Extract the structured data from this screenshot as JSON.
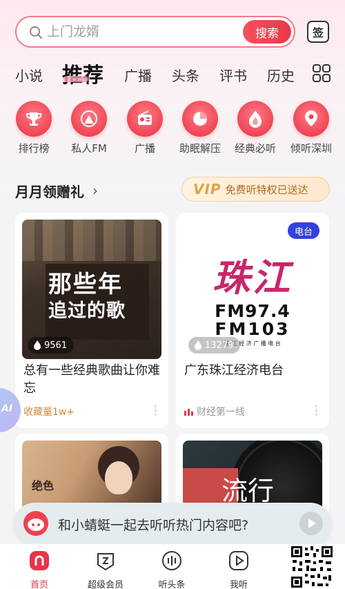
{
  "search": {
    "placeholder": "上门龙婿",
    "button_label": "搜索"
  },
  "sign_label": "签",
  "tabs": [
    {
      "label": "小说"
    },
    {
      "label": "推荐"
    },
    {
      "label": "广播"
    },
    {
      "label": "头条"
    },
    {
      "label": "评书"
    },
    {
      "label": "历史"
    }
  ],
  "quick_entries": [
    {
      "label": "排行榜",
      "icon": "trophy-icon"
    },
    {
      "label": "私人FM",
      "icon": "fm-icon"
    },
    {
      "label": "广播",
      "icon": "radio-icon"
    },
    {
      "label": "助眠解压",
      "icon": "moon-icon"
    },
    {
      "label": "经典必听",
      "icon": "flame-icon"
    },
    {
      "label": "倾听深圳",
      "icon": "location-icon"
    }
  ],
  "section": {
    "title": "月月领赠礼",
    "arrow": "›",
    "vip_mark": "VIP",
    "vip_text": "免费听特权已送达"
  },
  "cards": [
    {
      "cover_text_1": "那些年",
      "cover_text_2": "追过的歌",
      "plays": "9561",
      "title": "总有一些经典歌曲让你难忘",
      "meta": "收藏量1w+"
    },
    {
      "badge": "电台",
      "cover_text_1": "珠江",
      "cover_text_2": "FM97.4",
      "cover_text_3": "FM103",
      "cover_text_4": "珠 江 经 济 广 播 电 台",
      "plays": "13279",
      "title": "广东珠江经济电台",
      "meta": "财经第一线"
    },
    {
      "cover_text_1": "绝色"
    },
    {
      "cover_text_1": "流行"
    }
  ],
  "chat": {
    "text": "和小蜻蜓一起去听听热门内容吧?"
  },
  "bottom_nav": [
    {
      "label": "首页"
    },
    {
      "label": "超级会员"
    },
    {
      "label": "听头条"
    },
    {
      "label": "我听"
    }
  ],
  "ai_label": "AI",
  "colors": {
    "accent": "#ec3848",
    "radio_badge": "#3440e0",
    "vip_text": "#b36a1b"
  }
}
